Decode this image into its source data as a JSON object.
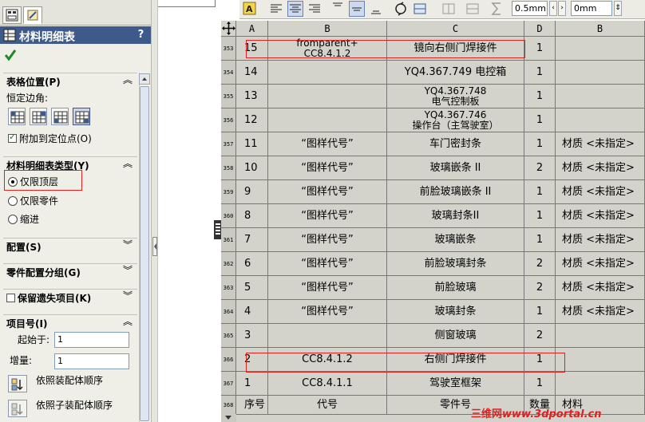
{
  "panel": {
    "title": "材料明细表",
    "help_label": "?",
    "groups": {
      "table_position": {
        "label": "表格位置(P)",
        "anchor_label": "恒定边角:",
        "attach_label": "附加到定位点(O)",
        "attach_checked": true
      },
      "bom_type": {
        "label": "材料明细表类型(Y)",
        "options": [
          "仅限顶层",
          "仅限零件",
          "缩进"
        ],
        "selected": "仅限顶层"
      },
      "configurations": {
        "label": "配置(S)"
      },
      "part_grouping": {
        "label": "零件配置分组(G)"
      },
      "keep_missing": {
        "label": "保留遗失项目(K)",
        "checked": false
      },
      "item_numbers": {
        "label": "项目号(I)",
        "start_label": "起始于:",
        "start_value": "1",
        "increment_label": "增量:",
        "increment_value": "1",
        "order_assembly_label": "依照装配体顺序",
        "order_subassembly_label": "依照子装配体顺序"
      }
    }
  },
  "toolbar": {
    "field1": "0.5mm",
    "field2": "0mm"
  },
  "table": {
    "columns": [
      "A",
      "B",
      "C",
      "D",
      "B"
    ],
    "rows": [
      {
        "num": "353",
        "a": "15",
        "b": "fromparent+\nCC8.4.1.2",
        "c": "镜向右侧门焊接件",
        "d": "1",
        "e": ""
      },
      {
        "num": "354",
        "a": "14",
        "b": "",
        "c": "YQ4.367.749 电控箱",
        "d": "1",
        "e": ""
      },
      {
        "num": "355",
        "a": "13",
        "b": "",
        "c": "YQ4.367.748\n电气控制板",
        "d": "1",
        "e": ""
      },
      {
        "num": "356",
        "a": "12",
        "b": "",
        "c": "YQ4.367.746\n操作台（主驾驶室）",
        "d": "1",
        "e": ""
      },
      {
        "num": "357",
        "a": "11",
        "b": "“图样代号”",
        "c": "车门密封条",
        "d": "1",
        "e": "材质 <未指定>"
      },
      {
        "num": "358",
        "a": "10",
        "b": "“图样代号”",
        "c": "玻璃嵌条 II",
        "d": "2",
        "e": "材质 <未指定>"
      },
      {
        "num": "359",
        "a": "9",
        "b": "“图样代号”",
        "c": "前脸玻璃嵌条 II",
        "d": "1",
        "e": "材质 <未指定>"
      },
      {
        "num": "360",
        "a": "8",
        "b": "“图样代号”",
        "c": "玻璃封条II",
        "d": "1",
        "e": "材质 <未指定>"
      },
      {
        "num": "361",
        "a": "7",
        "b": "“图样代号”",
        "c": "玻璃嵌条",
        "d": "1",
        "e": "材质 <未指定>"
      },
      {
        "num": "362",
        "a": "6",
        "b": "“图样代号”",
        "c": "前脸玻璃封条",
        "d": "2",
        "e": "材质 <未指定>"
      },
      {
        "num": "363",
        "a": "5",
        "b": "“图样代号”",
        "c": "前脸玻璃",
        "d": "2",
        "e": "材质 <未指定>"
      },
      {
        "num": "364",
        "a": "4",
        "b": "“图样代号”",
        "c": "玻璃封条",
        "d": "1",
        "e": "材质 <未指定>"
      },
      {
        "num": "365",
        "a": "3",
        "b": "",
        "c": "侧窗玻璃",
        "d": "2",
        "e": ""
      },
      {
        "num": "366",
        "a": "2",
        "b": "CC8.4.1.2",
        "c": "右侧门焊接件",
        "d": "1",
        "e": ""
      },
      {
        "num": "367",
        "a": "1",
        "b": "CC8.4.1.1",
        "c": "驾驶室框架",
        "d": "1",
        "e": ""
      },
      {
        "num": "368",
        "a": "序号",
        "b": "代号",
        "c": "零件号",
        "d": "数量",
        "e": "材料"
      }
    ]
  },
  "watermark": {
    "cn": "三维网",
    "url": "www.3dportal.cn"
  },
  "colors": {
    "header_bg": "#3e5a8a",
    "highlight": "#e02020",
    "table_bg": "#d3d3cb"
  }
}
